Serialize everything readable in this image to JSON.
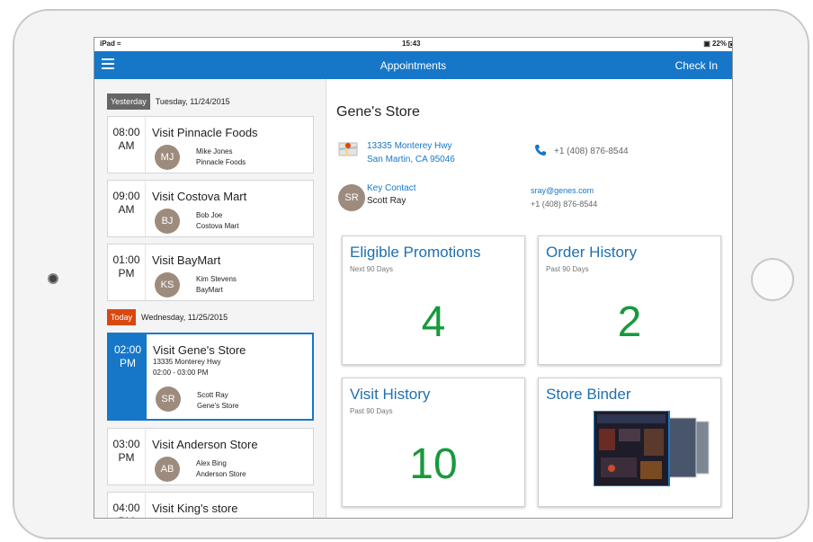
{
  "status": {
    "device": "iPad",
    "time": "15:43",
    "battery": "22%"
  },
  "nav": {
    "title": "Appointments",
    "right": "Check In"
  },
  "days": [
    {
      "tag": "Yesterday",
      "date": "Tuesday, 11/24/2015"
    },
    {
      "tag": "Today",
      "date": "Wednesday, 11/25/2015"
    }
  ],
  "appointments": [
    {
      "time": "08:00",
      "ampm": "AM",
      "title": "Visit Pinnacle Foods",
      "initials": "MJ",
      "person": "Mike Jones",
      "company": "Pinnacle Foods"
    },
    {
      "time": "09:00",
      "ampm": "AM",
      "title": "Visit Costova Mart",
      "initials": "BJ",
      "person": "Bob Joe",
      "company": "Costova Mart"
    },
    {
      "time": "01:00",
      "ampm": "PM",
      "title": "Visit BayMart",
      "initials": "KS",
      "person": "Kim Stevens",
      "company": "BayMart"
    },
    {
      "time": "02:00",
      "ampm": "PM",
      "title": "Visit Gene's Store",
      "address": "13335 Monterey Hwy",
      "range": "02:00 - 03:00 PM",
      "initials": "SR",
      "person": "Scott Ray",
      "company": "Gene's Store"
    },
    {
      "time": "03:00",
      "ampm": "PM",
      "title": "Visit Anderson Store",
      "initials": "AB",
      "person": "Alex Bing",
      "company": "Anderson Store"
    },
    {
      "time": "04:00",
      "ampm": "PM",
      "title": "Visit King's store",
      "initials": "",
      "person": "",
      "company": ""
    }
  ],
  "detail": {
    "store": "Gene's Store",
    "address1": "13335 Monterey Hwy",
    "address2": "San Martin, CA 95046",
    "phone": "+1 (408) 876-8544",
    "contact_label": "Key Contact",
    "contact_initials": "SR",
    "contact_name": "Scott Ray",
    "contact_email": "sray@genes.com",
    "contact_phone": "+1 (408) 876-8544"
  },
  "tiles": [
    {
      "title": "Eligible Promotions",
      "sub": "Next 90 Days",
      "value": "4"
    },
    {
      "title": "Order History",
      "sub": "Past 90 Days",
      "value": "2"
    },
    {
      "title": "Visit History",
      "sub": "Past 90 Days",
      "value": "10"
    },
    {
      "title": "Store Binder",
      "sub": "",
      "value": ""
    }
  ],
  "colors": {
    "brand": "#1677c9",
    "today": "#d9480f",
    "number": "#18993b"
  }
}
